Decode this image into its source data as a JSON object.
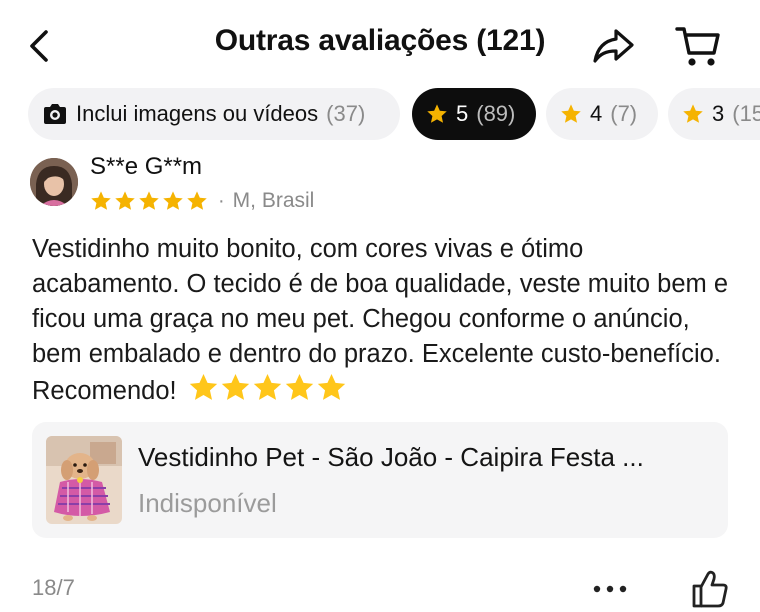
{
  "header": {
    "title": "Outras avaliações (121)",
    "back_icon": "chevron-left-icon",
    "share_icon": "share-arrow-icon",
    "cart_icon": "cart-icon"
  },
  "filters": [
    {
      "label": "Inclui imagens ou vídeos",
      "count": "(37)",
      "icon": "camera-icon",
      "active": false
    },
    {
      "label": "5",
      "count": "(89)",
      "icon": "star-icon",
      "active": true
    },
    {
      "label": "4",
      "count": "(7)",
      "icon": "star-icon",
      "active": false
    },
    {
      "label": "3",
      "count": "(15",
      "icon": "star-icon",
      "active": false
    }
  ],
  "review": {
    "reviewer_name": "S**e G**m",
    "rating": 5,
    "meta": "M, Brasil",
    "text": "Vestidinho muito bonito, com cores vivas e ótimo acabamento. O tecido é de boa qualidade, veste muito bem e ficou uma graça no meu pet. Chegou conforme o anúncio, bem embalado e dentro do prazo. Excelente custo-benefício. Recomendo!",
    "emoji_stars": 5,
    "date": "18/7"
  },
  "product": {
    "title": "Vestidinho Pet - São João - Caipira Festa ...",
    "status": "Indisponível"
  },
  "colors": {
    "star": "#F5B301",
    "chip_bg": "#F2F2F4",
    "chip_active_bg": "#0D0D0D",
    "muted_text": "#8A8A8A",
    "card_bg": "#F5F5F6"
  }
}
